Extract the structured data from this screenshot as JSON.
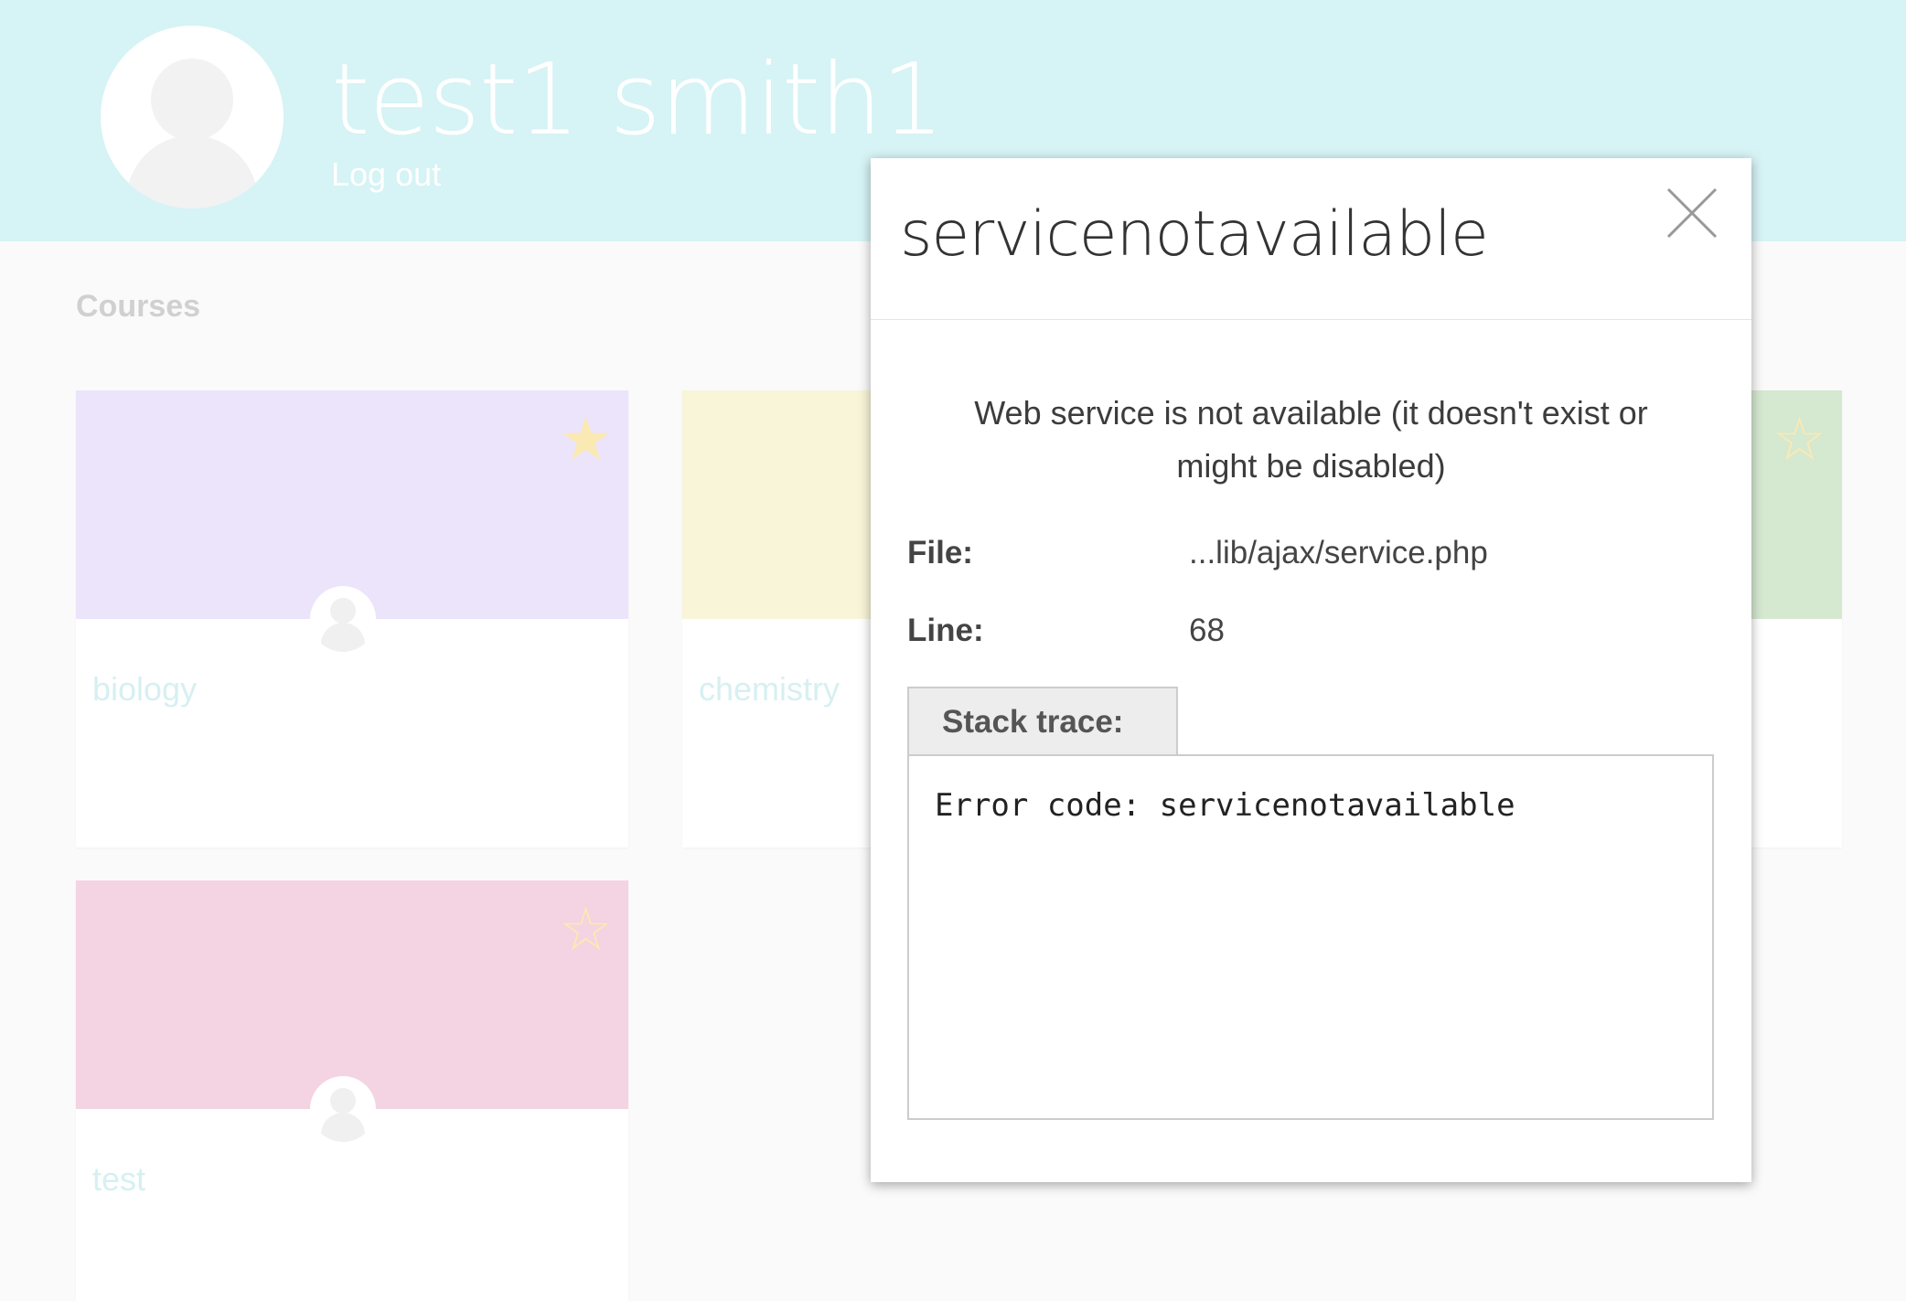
{
  "header": {
    "user_name": "test1 smith1",
    "logout_label": "Log out",
    "background": "#d6f3f5"
  },
  "courses_section": {
    "label": "Courses",
    "cards": [
      {
        "name": "biology",
        "color": "#ebe4fb",
        "starred": true,
        "star_icon": "star-filled-icon"
      },
      {
        "name": "chemistry",
        "color": "#f8f5d8",
        "starred": false
      },
      {
        "name": "",
        "color": "#d5e8d0",
        "starred": false,
        "star_icon": "star-outline-icon"
      },
      {
        "name": "test",
        "color": "#f4d3e2",
        "starred": false,
        "star_icon": "star-outline-icon"
      }
    ]
  },
  "error_dialog": {
    "title": "servicenotavailable",
    "close_icon": "close-icon",
    "message": "Web service is not available (it doesn't exist or might be disabled)",
    "file_label": "File:",
    "file_value": "...lib/ajax/service.php",
    "line_label": "Line:",
    "line_value": "68",
    "stack_trace_label": "Stack trace:",
    "stack_trace_text": "Error code: servicenotavailable"
  }
}
